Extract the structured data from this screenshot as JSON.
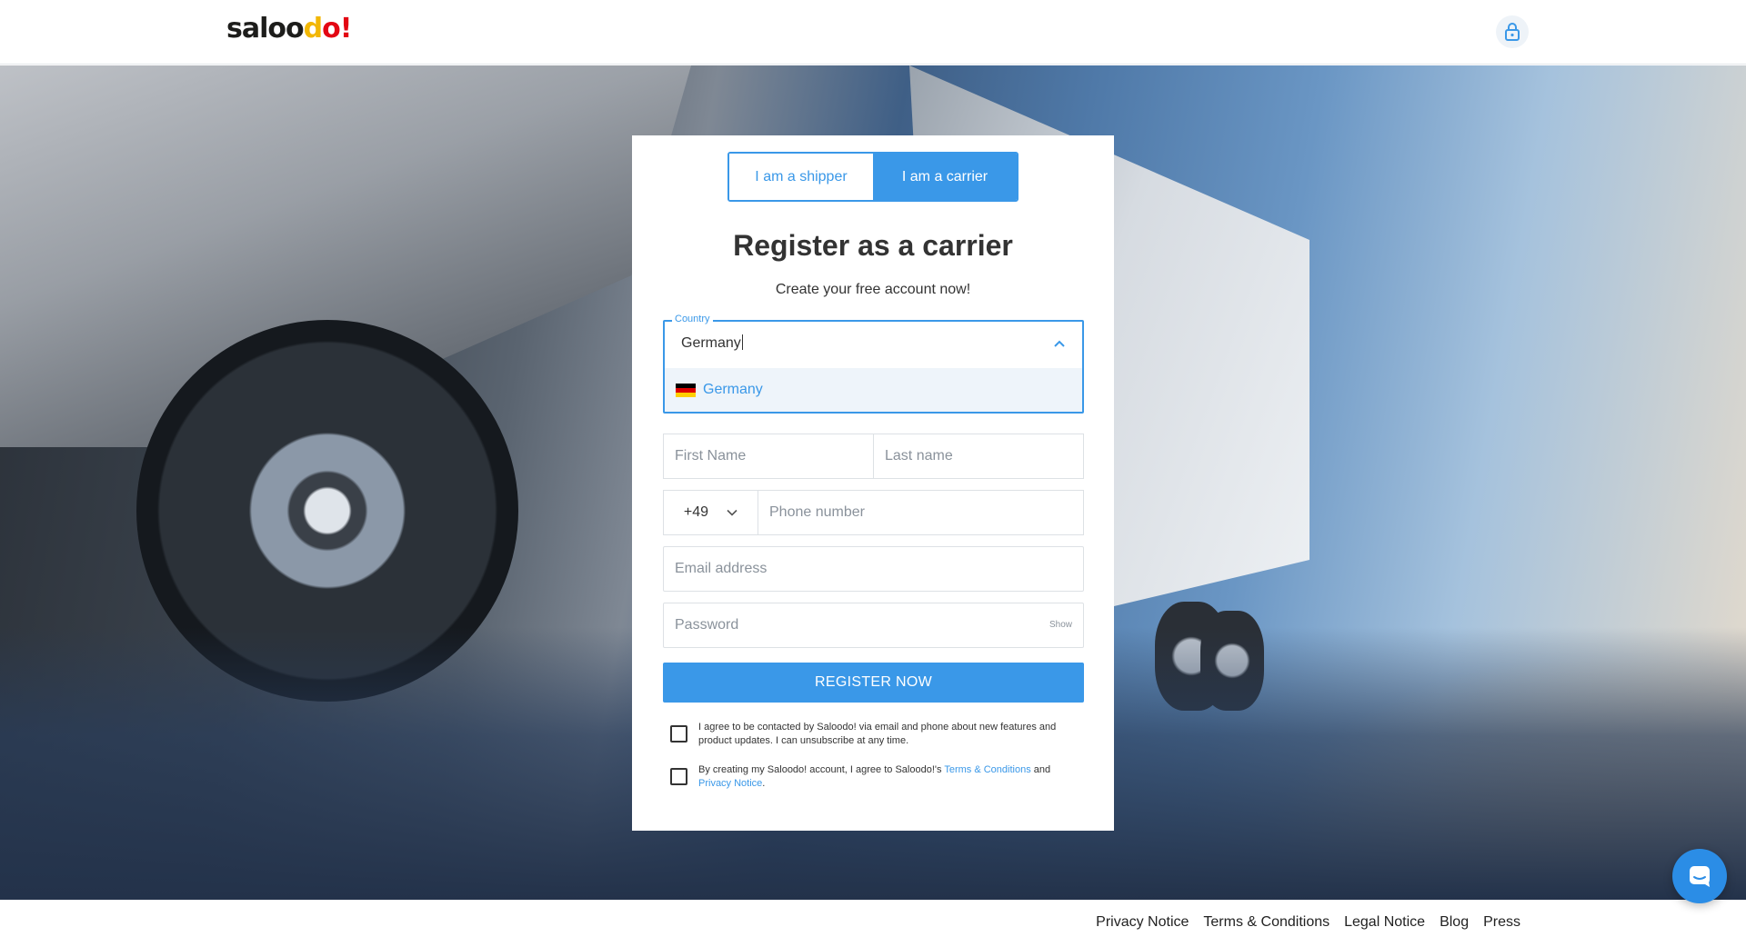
{
  "header": {
    "logo_text": "saloodo!",
    "lock_icon": "lock-icon"
  },
  "form": {
    "toggle": {
      "shipper_label": "I am a shipper",
      "carrier_label": "I am a carrier",
      "selected": "carrier"
    },
    "title": "Register as a carrier",
    "subtitle": "Create your free account now!",
    "country": {
      "legend": "Country",
      "value": "Germany",
      "option_label": "Germany",
      "flag_colors": [
        "#000000",
        "#dd0000",
        "#ffce00"
      ]
    },
    "first_name_placeholder": "First Name",
    "last_name_placeholder": "Last name",
    "phone_prefix": "+49",
    "phone_placeholder": "Phone number",
    "email_placeholder": "Email address",
    "password_placeholder": "Password",
    "show_label": "Show",
    "register_label": "REGISTER NOW",
    "consent_contact": "I agree to be contacted by Saloodo! via email and phone about new features and product updates. I can unsubscribe at any time.",
    "consent_terms_prefix": "By creating my Saloodo! account, I agree to Saloodo!'s",
    "consent_terms_link": "Terms & Conditions",
    "consent_terms_and": "and",
    "consent_privacy_link": "Privacy Notice",
    "consent_terms_end": "."
  },
  "footer": {
    "links": [
      "Privacy Notice",
      "Terms & Conditions",
      "Legal Notice",
      "Blog",
      "Press"
    ]
  },
  "colors": {
    "accent": "#3a98e8",
    "brand_yellow": "#f2b705",
    "brand_red": "#e30613"
  },
  "chat": {
    "icon": "chat-icon"
  }
}
